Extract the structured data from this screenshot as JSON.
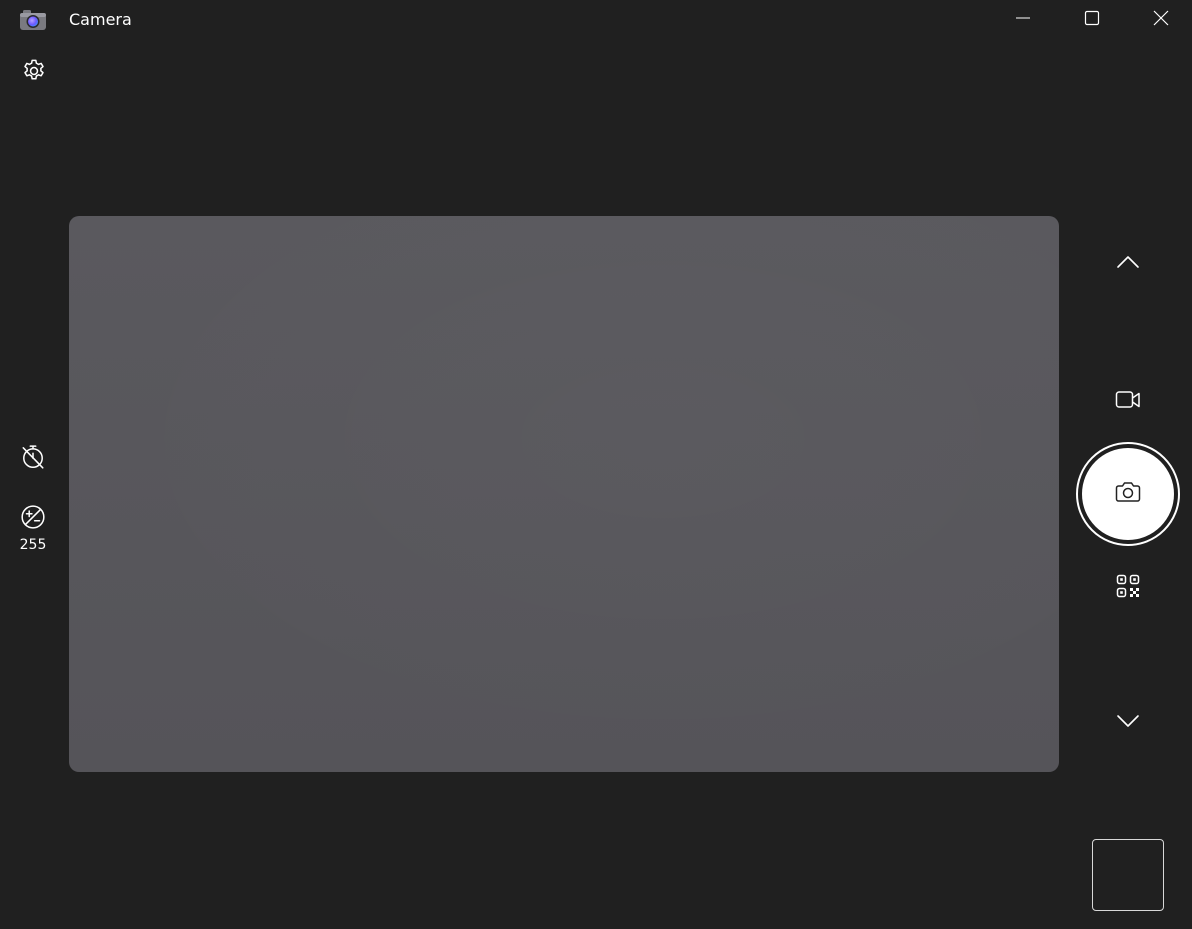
{
  "window": {
    "title": "Camera",
    "app_icon": "camera-app-icon",
    "controls": {
      "minimize": "minimize-icon",
      "maximize": "maximize-icon",
      "close": "close-icon"
    }
  },
  "left_toolbar": {
    "settings_icon": "gear-icon",
    "timer_icon": "timer-off-icon",
    "brightness_icon": "brightness-icon",
    "brightness_value": "255"
  },
  "right_toolbar": {
    "scroll_up_icon": "chevron-up-icon",
    "video_mode_icon": "video-camera-icon",
    "shutter_icon": "camera-icon",
    "qr_mode_icon": "qr-code-icon",
    "scroll_down_icon": "chevron-down-icon"
  },
  "colors": {
    "background": "#202020",
    "preview": "#57565b",
    "foreground": "#ffffff"
  }
}
